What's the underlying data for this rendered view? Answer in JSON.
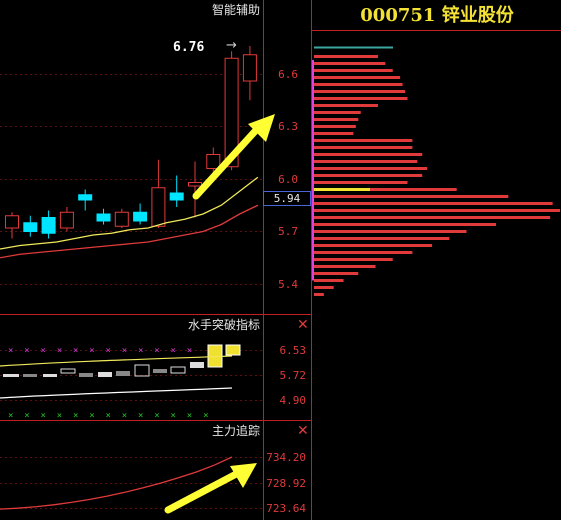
{
  "stock": {
    "code": "000751",
    "name": "锌业股份",
    "title": "000751  锌业股份"
  },
  "main_panel": {
    "title": "智能辅助",
    "high_label": "6.76",
    "high_arrow": "→",
    "current_price": "5.94",
    "price_ticks": [
      "6.6",
      "6.3",
      "6.0",
      "5.7",
      "5.4"
    ]
  },
  "indicator1": {
    "title": "水手突破指标",
    "ticks": [
      "6.53",
      "5.72",
      "4.90"
    ],
    "close_icon": "✕"
  },
  "indicator2": {
    "title": "主力追踪",
    "ticks": [
      "734.20",
      "728.92",
      "723.64"
    ],
    "close_icon": "✕"
  },
  "colors": {
    "background": "#000000",
    "up_candle": "#e03a3a",
    "down_candle": "#00e5ff",
    "ma_short": "#f0e85a",
    "ma_long": "#e03a3a",
    "annotation_arrow": "#ffff33",
    "title_text": "#f3e233",
    "volume_profile": "#e03a3a"
  },
  "chart_data": [
    {
      "type": "candlestick",
      "title": "智能辅助",
      "candles": [
        {
          "open": 5.72,
          "close": 5.79,
          "high": 5.81,
          "low": 5.66
        },
        {
          "open": 5.75,
          "close": 5.7,
          "high": 5.79,
          "low": 5.67
        },
        {
          "open": 5.78,
          "close": 5.69,
          "high": 5.82,
          "low": 5.66
        },
        {
          "open": 5.72,
          "close": 5.81,
          "high": 5.84,
          "low": 5.7
        },
        {
          "open": 5.91,
          "close": 5.88,
          "high": 5.94,
          "low": 5.82
        },
        {
          "open": 5.8,
          "close": 5.76,
          "high": 5.83,
          "low": 5.74
        },
        {
          "open": 5.73,
          "close": 5.81,
          "high": 5.83,
          "low": 5.72
        },
        {
          "open": 5.81,
          "close": 5.76,
          "high": 5.86,
          "low": 5.74
        },
        {
          "open": 5.73,
          "close": 5.95,
          "high": 6.11,
          "low": 5.72
        },
        {
          "open": 5.92,
          "close": 5.88,
          "high": 6.02,
          "low": 5.84
        },
        {
          "open": 5.96,
          "close": 5.98,
          "high": 6.1,
          "low": 5.78
        },
        {
          "open": 6.06,
          "close": 6.14,
          "high": 6.18,
          "low": 6.01
        },
        {
          "open": 6.07,
          "close": 6.69,
          "high": 6.73,
          "low": 6.05
        },
        {
          "open": 6.56,
          "close": 6.71,
          "high": 6.76,
          "low": 6.45
        }
      ],
      "ma_short": [
        5.62,
        5.63,
        5.64,
        5.66,
        5.68,
        5.69,
        5.71,
        5.72,
        5.75,
        5.77,
        5.8,
        5.85,
        5.93,
        6.01
      ],
      "ma_long": [
        5.57,
        5.58,
        5.59,
        5.6,
        5.61,
        5.62,
        5.63,
        5.64,
        5.66,
        5.68,
        5.7,
        5.74,
        5.8,
        5.85
      ],
      "ylim": [
        5.2,
        6.8
      ],
      "y_ticks": [
        6.6,
        6.3,
        6.0,
        5.7,
        5.4
      ]
    },
    {
      "type": "bar",
      "title": "",
      "orientation": "horizontal",
      "note": "volume-by-price profile, relative lengths",
      "price": [
        6.7,
        6.66,
        6.62,
        6.58,
        6.54,
        6.5,
        6.46,
        6.42,
        6.38,
        6.34,
        6.3,
        6.26,
        6.22,
        6.18,
        6.14,
        6.1,
        6.06,
        6.02,
        5.98,
        5.94,
        5.9,
        5.86,
        5.82,
        5.78,
        5.74,
        5.7,
        5.66,
        5.62,
        5.58,
        5.54,
        5.5,
        5.46,
        5.42,
        5.38,
        5.34
      ],
      "values": [
        0.26,
        0.29,
        0.32,
        0.35,
        0.36,
        0.37,
        0.38,
        0.26,
        0.19,
        0.18,
        0.17,
        0.16,
        0.4,
        0.4,
        0.44,
        0.42,
        0.46,
        0.44,
        0.38,
        0.58,
        0.79,
        0.97,
        1.0,
        0.96,
        0.74,
        0.62,
        0.55,
        0.48,
        0.4,
        0.32,
        0.25,
        0.18,
        0.12,
        0.08,
        0.04
      ],
      "current_price": 5.94,
      "ylim": [
        5.2,
        6.8
      ]
    },
    {
      "type": "line",
      "title": "水手突破指标",
      "y_ticks": [
        6.53,
        5.72,
        4.9
      ],
      "ylim": [
        4.6,
        6.9
      ]
    },
    {
      "type": "line",
      "title": "主力追踪",
      "series": [
        {
          "values": [
            723.4,
            723.6,
            723.9,
            724.3,
            724.8,
            725.4,
            726.1,
            726.9,
            727.8,
            728.8,
            729.9,
            731.1,
            732.5,
            734.2
          ]
        }
      ],
      "y_ticks": [
        734.2,
        728.92,
        723.64
      ],
      "ylim": [
        723.3,
        736.0
      ]
    }
  ]
}
